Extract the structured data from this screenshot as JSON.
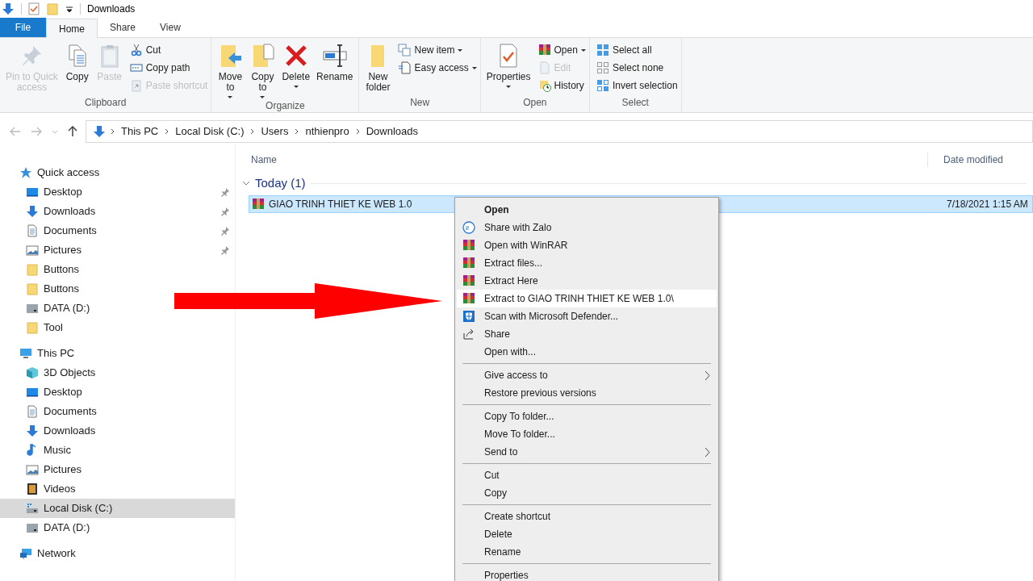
{
  "title_bar": {
    "title": "Downloads"
  },
  "ribbon_tabs": [
    {
      "label": "File",
      "kind": "file",
      "selected": false
    },
    {
      "label": "Home",
      "kind": "tab",
      "selected": true
    },
    {
      "label": "Share",
      "kind": "tab",
      "selected": false
    },
    {
      "label": "View",
      "kind": "tab",
      "selected": false
    }
  ],
  "ribbon_groups": [
    {
      "label": "Clipboard",
      "items": [
        {
          "label": "Pin to Quick access",
          "kind": "large",
          "disabled": true,
          "dropdown": false
        },
        {
          "label": "Copy",
          "kind": "large",
          "disabled": false,
          "dropdown": false
        },
        {
          "label": "Paste",
          "kind": "large",
          "disabled": true,
          "dropdown": false
        },
        {
          "label": "Cut",
          "kind": "small",
          "disabled": false,
          "dropdown": false
        },
        {
          "label": "Copy path",
          "kind": "small",
          "disabled": false,
          "dropdown": false
        },
        {
          "label": "Paste shortcut",
          "kind": "small",
          "disabled": true,
          "dropdown": false
        }
      ]
    },
    {
      "label": "Organize",
      "items": [
        {
          "label": "Move to",
          "kind": "large",
          "disabled": false,
          "dropdown": true
        },
        {
          "label": "Copy to",
          "kind": "large",
          "disabled": false,
          "dropdown": true
        },
        {
          "label": "Delete",
          "kind": "large",
          "disabled": false,
          "dropdown": true
        },
        {
          "label": "Rename",
          "kind": "large",
          "disabled": false,
          "dropdown": false
        }
      ]
    },
    {
      "label": "New",
      "items": [
        {
          "label": "New folder",
          "kind": "large",
          "disabled": false,
          "dropdown": false
        },
        {
          "label": "New item",
          "kind": "small",
          "disabled": false,
          "dropdown": true
        },
        {
          "label": "Easy access",
          "kind": "small",
          "disabled": false,
          "dropdown": true
        }
      ]
    },
    {
      "label": "Open",
      "items": [
        {
          "label": "Properties",
          "kind": "large",
          "disabled": false,
          "dropdown": true
        },
        {
          "label": "Open",
          "kind": "small",
          "disabled": false,
          "dropdown": true
        },
        {
          "label": "Edit",
          "kind": "small",
          "disabled": true,
          "dropdown": false
        },
        {
          "label": "History",
          "kind": "small",
          "disabled": false,
          "dropdown": false
        }
      ]
    },
    {
      "label": "Select",
      "items": [
        {
          "label": "Select all",
          "kind": "small",
          "disabled": false,
          "dropdown": false
        },
        {
          "label": "Select none",
          "kind": "small",
          "disabled": false,
          "dropdown": false
        },
        {
          "label": "Invert selection",
          "kind": "small",
          "disabled": false,
          "dropdown": false
        }
      ]
    }
  ],
  "address_bar": {
    "path": [
      "This PC",
      "Local Disk (C:)",
      "Users",
      "nthienpro",
      "Downloads"
    ]
  },
  "navigation": [
    {
      "label": "Quick access",
      "children": [
        {
          "label": "Desktop",
          "pinned": true,
          "selected": false
        },
        {
          "label": "Downloads",
          "pinned": true,
          "selected": false
        },
        {
          "label": "Documents",
          "pinned": true,
          "selected": false
        },
        {
          "label": "Pictures",
          "pinned": true,
          "selected": false
        },
        {
          "label": "Buttons",
          "pinned": false,
          "selected": false
        },
        {
          "label": "Buttons",
          "pinned": false,
          "selected": false
        },
        {
          "label": "DATA (D:)",
          "pinned": false,
          "selected": false
        },
        {
          "label": "Tool",
          "pinned": false,
          "selected": false
        }
      ]
    },
    {
      "label": "This PC",
      "children": [
        {
          "label": "3D Objects",
          "pinned": false,
          "selected": false
        },
        {
          "label": "Desktop",
          "pinned": false,
          "selected": false
        },
        {
          "label": "Documents",
          "pinned": false,
          "selected": false
        },
        {
          "label": "Downloads",
          "pinned": false,
          "selected": false
        },
        {
          "label": "Music",
          "pinned": false,
          "selected": false
        },
        {
          "label": "Pictures",
          "pinned": false,
          "selected": false
        },
        {
          "label": "Videos",
          "pinned": false,
          "selected": false
        },
        {
          "label": "Local Disk (C:)",
          "pinned": false,
          "selected": true
        },
        {
          "label": "DATA (D:)",
          "pinned": false,
          "selected": false
        }
      ]
    },
    {
      "label": "Network"
    }
  ],
  "file_list": {
    "columns": [
      "Name",
      "Date modified"
    ],
    "groups": [
      {
        "label": "Today (1)",
        "expanded": true,
        "files": [
          {
            "name": "GIAO TRINH THIET KE WEB 1.0",
            "date": "7/18/2021 1:15 AM",
            "selected": true
          }
        ]
      }
    ]
  },
  "context_menu": {
    "sections": [
      {
        "items": [
          {
            "label": "Open",
            "default": true,
            "submenu": false,
            "selected": false
          },
          {
            "label": "Share with Zalo",
            "default": false,
            "submenu": false,
            "selected": false
          },
          {
            "label": "Open with WinRAR",
            "default": false,
            "submenu": false,
            "selected": false
          },
          {
            "label": "Extract files...",
            "default": false,
            "submenu": false,
            "selected": false
          },
          {
            "label": "Extract Here",
            "default": false,
            "submenu": false,
            "selected": false
          },
          {
            "label": "Extract to GIAO TRINH THIET KE WEB 1.0\\",
            "default": false,
            "submenu": false,
            "selected": true
          },
          {
            "label": "Scan with Microsoft Defender...",
            "default": false,
            "submenu": false,
            "selected": false
          },
          {
            "label": "Share",
            "default": false,
            "submenu": false,
            "selected": false
          },
          {
            "label": "Open with...",
            "default": false,
            "submenu": false,
            "selected": false
          }
        ]
      },
      {
        "items": [
          {
            "label": "Give access to",
            "default": false,
            "submenu": true,
            "selected": false
          },
          {
            "label": "Restore previous versions",
            "default": false,
            "submenu": false,
            "selected": false
          }
        ]
      },
      {
        "items": [
          {
            "label": "Copy To folder...",
            "default": false,
            "submenu": false,
            "selected": false
          },
          {
            "label": "Move To folder...",
            "default": false,
            "submenu": false,
            "selected": false
          },
          {
            "label": "Send to",
            "default": false,
            "submenu": true,
            "selected": false
          }
        ]
      },
      {
        "items": [
          {
            "label": "Cut",
            "default": false,
            "submenu": false,
            "selected": false
          },
          {
            "label": "Copy",
            "default": false,
            "submenu": false,
            "selected": false
          }
        ]
      },
      {
        "items": [
          {
            "label": "Create shortcut",
            "default": false,
            "submenu": false,
            "selected": false
          },
          {
            "label": "Delete",
            "default": false,
            "submenu": false,
            "selected": false
          },
          {
            "label": "Rename",
            "default": false,
            "submenu": false,
            "selected": false
          }
        ]
      },
      {
        "items": [
          {
            "label": "Properties",
            "default": false,
            "submenu": false,
            "selected": false
          }
        ]
      }
    ]
  }
}
